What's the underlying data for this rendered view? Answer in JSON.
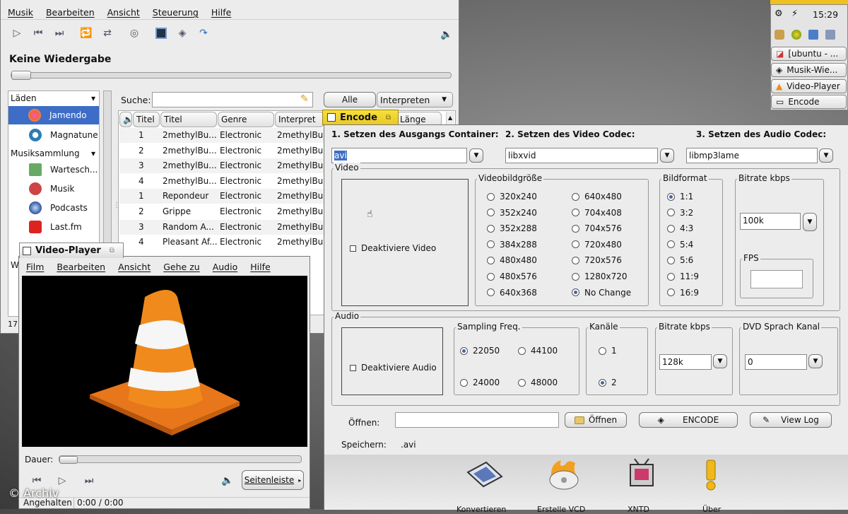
{
  "music_player": {
    "menu": [
      "Musik",
      "Bearbeiten",
      "Ansicht",
      "Steuerung",
      "Hilfe"
    ],
    "now_playing": "Keine Wiedergabe",
    "search_label": "Suche:",
    "search_value": "",
    "filter_all": "Alle",
    "filter_select": "Interpreten",
    "sources_header": "Läden",
    "sources": [
      "Jamendo",
      "Magnatune"
    ],
    "collection_header": "Musiksammlung",
    "collection": [
      "Warteschlange",
      "Musik",
      "Podcasts",
      "Last.fm"
    ],
    "collection_display": [
      "Wartesch...",
      "Musik",
      "Podcasts",
      "Last.fm"
    ],
    "columns": [
      "Titel",
      "Titel",
      "Genre",
      "Interpret",
      "Länge"
    ],
    "rows": [
      {
        "track": "1",
        "title": "2methylBu...",
        "genre": "Electronic",
        "artist": "2methylBu..."
      },
      {
        "track": "2",
        "title": "2methylBu...",
        "genre": "Electronic",
        "artist": "2methylBu..."
      },
      {
        "track": "3",
        "title": "2methylBu...",
        "genre": "Electronic",
        "artist": "2methylBu..."
      },
      {
        "track": "4",
        "title": "2methylBu...",
        "genre": "Electronic",
        "artist": "2methylBu..."
      },
      {
        "track": "1",
        "title": "Repondeur",
        "genre": "Electronic",
        "artist": "2methylBu..."
      },
      {
        "track": "2",
        "title": "Grippe",
        "genre": "Electronic",
        "artist": "2methylBu..."
      },
      {
        "track": "3",
        "title": "Random A...",
        "genre": "Electronic",
        "artist": "2methylBu..."
      },
      {
        "track": "4",
        "title": "Pleasant Af...",
        "genre": "Electronic",
        "artist": "2methylBu..."
      }
    ],
    "status_count": "17"
  },
  "panel": {
    "clock": "15:29",
    "tasks": [
      "[ubuntu - ...",
      "Musik-Wie...",
      "Video-Player",
      "Encode"
    ]
  },
  "video_player": {
    "title": "Video-Player",
    "menu": [
      "Film",
      "Bearbeiten",
      "Ansicht",
      "Gehe zu",
      "Audio",
      "Hilfe"
    ],
    "duration_label": "Dauer:",
    "sidebar_button": "Seitenleiste",
    "status": "Angehalten",
    "time": "0:00 / 0:00",
    "watermark": "© Archiv"
  },
  "encode": {
    "title": "Encode",
    "step1": "1. Setzen des Ausgangs Container:",
    "step2": "2. Setzen des Video Codec:",
    "step3": "3. Setzen des Audio Codec:",
    "container": "avi",
    "video_codec": "libxvid",
    "audio_codec": "libmp3lame",
    "video_group": "Video",
    "disable_video": "Deaktiviere Video",
    "size_group": "Videobildgröße",
    "sizes_left": [
      "320x240",
      "352x240",
      "352x288",
      "384x288",
      "480x480",
      "480x576",
      "640x368"
    ],
    "sizes_right": [
      "640x480",
      "704x408",
      "704x576",
      "720x480",
      "720x576",
      "1280x720",
      "No Change"
    ],
    "size_selected": "No Change",
    "aspect_group": "Bildformat",
    "aspects": [
      "1:1",
      "3:2",
      "4:3",
      "5:4",
      "5:6",
      "11:9",
      "16:9"
    ],
    "aspect_selected": "1:1",
    "vbitrate_group": "Bitrate kbps",
    "vbitrate": "100k",
    "fps_group": "FPS",
    "fps": "",
    "audio_group": "Audio",
    "disable_audio": "Deaktiviere Audio",
    "sampling_group": "Sampling Freq.",
    "sampling": [
      "22050",
      "44100",
      "24000",
      "48000"
    ],
    "sampling_selected": "22050",
    "channels_group": "Kanäle",
    "channels": [
      "1",
      "2"
    ],
    "channels_selected": "2",
    "abitrate_group": "Bitrate kbps",
    "abitrate": "128k",
    "dvd_group": "DVD Sprach Kanal",
    "dvd_channel": "0",
    "open_label": "Öffnen:",
    "open_value": "",
    "open_button": "Öffnen",
    "encode_button": "ENCODE",
    "log_button": "View Log",
    "save_label": "Speichern:",
    "save_value": ".avi",
    "bottom_tools": [
      "Konvertieren",
      "Erstelle VCD",
      "XNTD",
      "Über"
    ]
  },
  "colors": {
    "selection": "#3d6dc7",
    "accent_orange": "#f08a1c"
  }
}
